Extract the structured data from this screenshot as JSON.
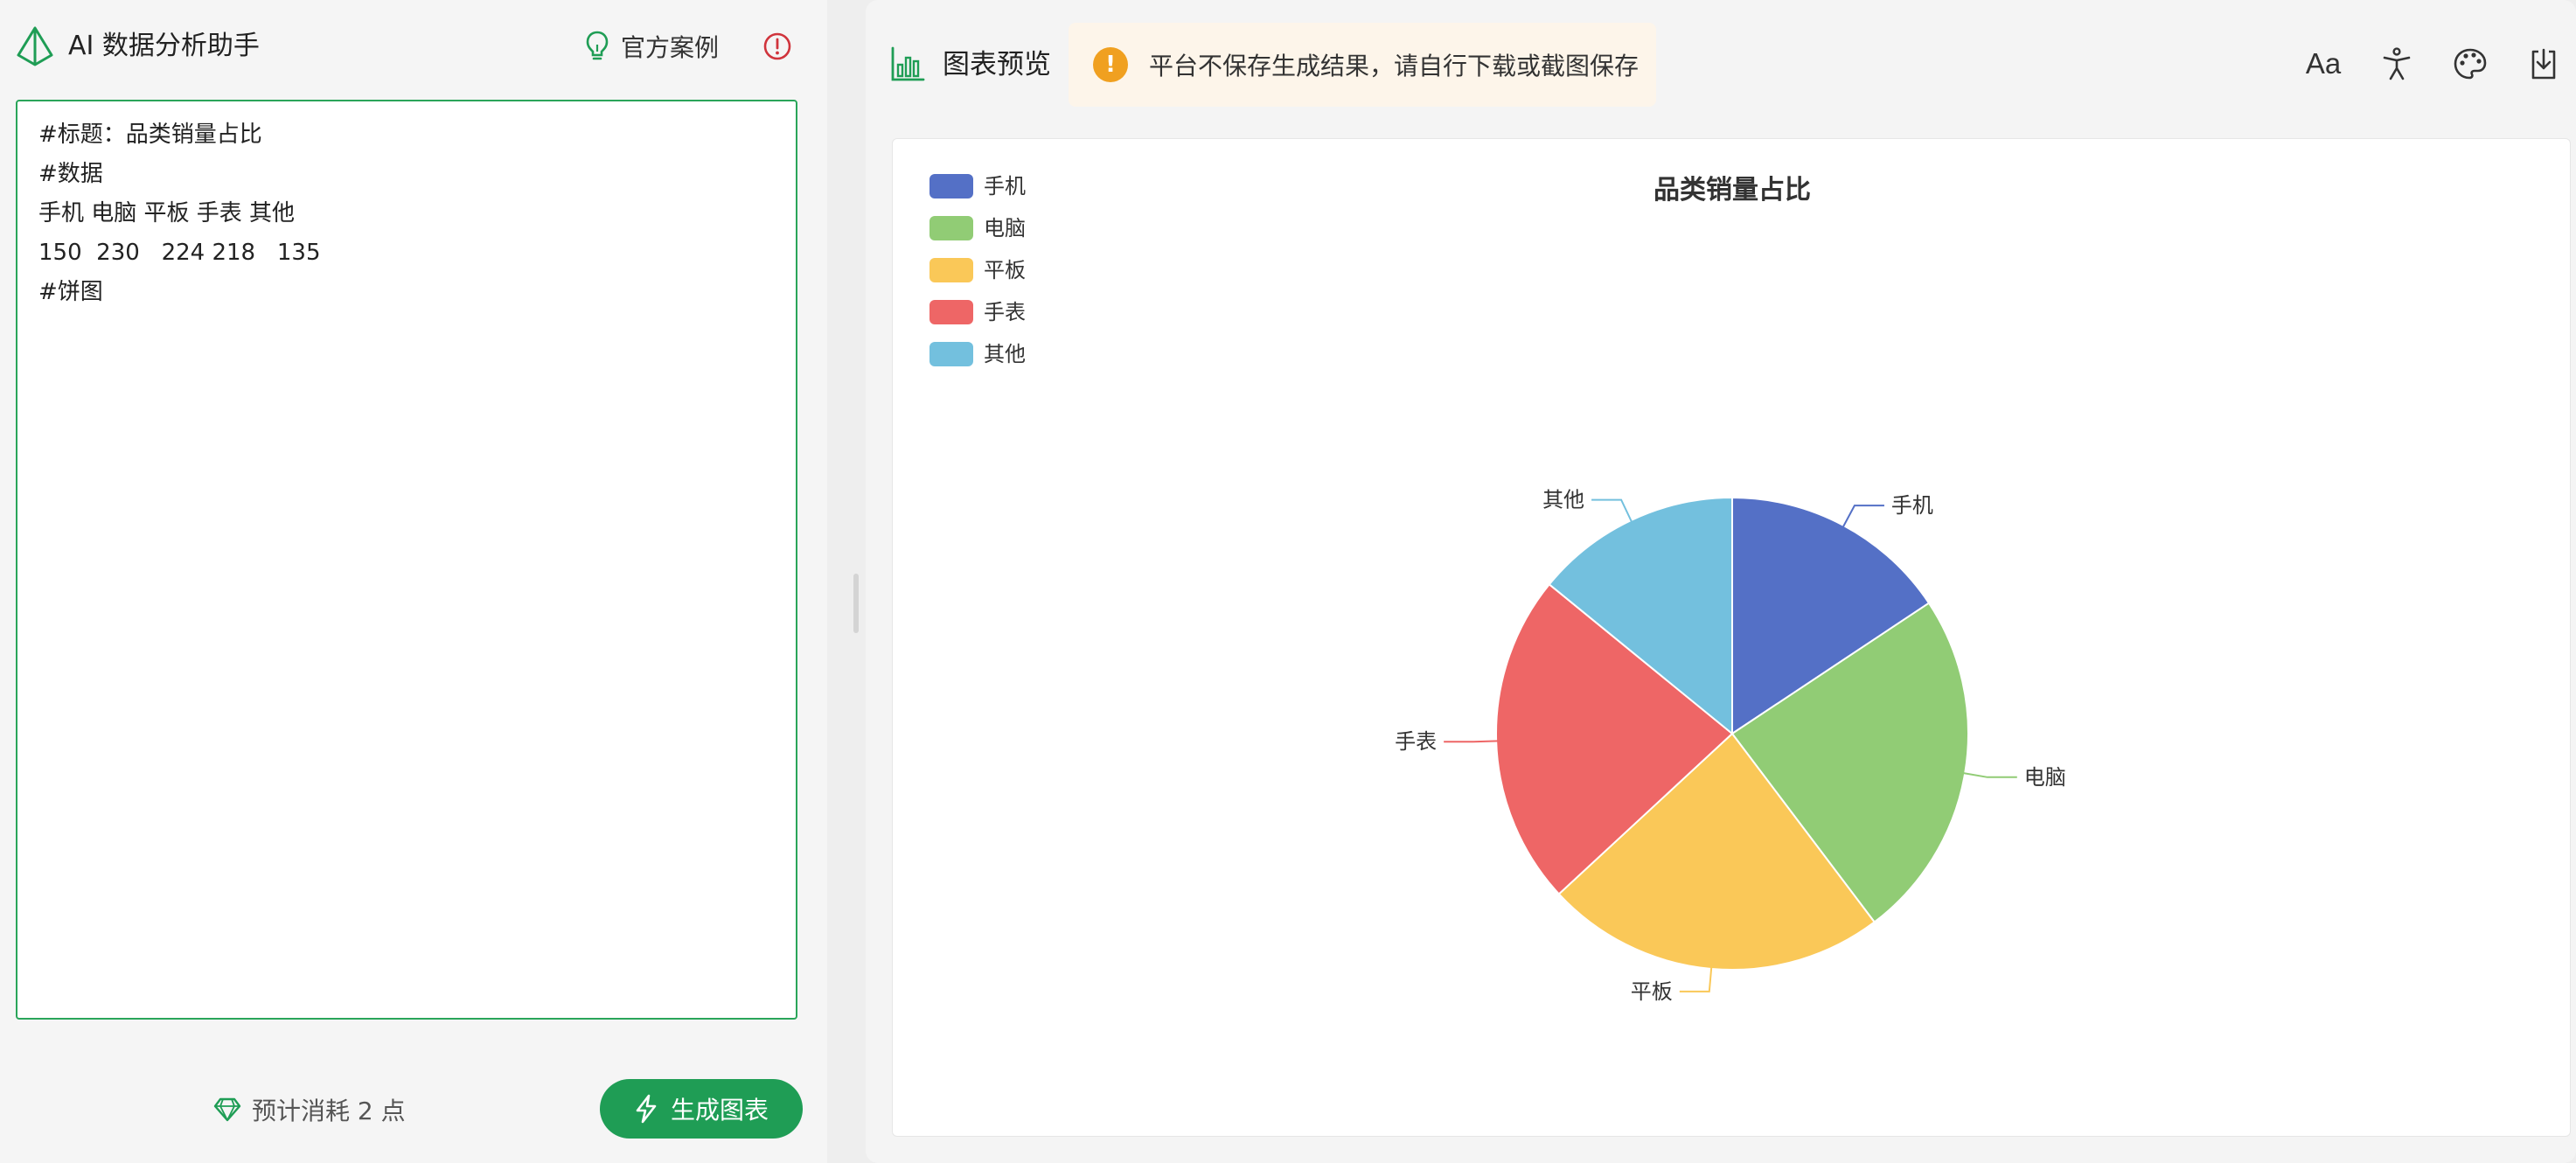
{
  "app": {
    "title": "AI 数据分析助手",
    "examples_label": "官方案例"
  },
  "editor": {
    "lines": [
      "#标题：品类销量占比",
      "#数据",
      "手机 电脑 平板 手表 其他",
      "150  230   224 218   135",
      "#饼图"
    ]
  },
  "footer": {
    "cost_label": "预计消耗 2 点",
    "generate_label": "生成图表"
  },
  "preview": {
    "title": "图表预览",
    "notice": "平台不保存生成结果，请自行下载或截图保存",
    "font_button": "Aa"
  },
  "icons": {
    "logo": "pyramid-logo-icon",
    "examples": "lightbulb-icon",
    "info": "alert-circle-icon",
    "cost": "diamond-icon",
    "generate": "lightning-icon",
    "preview": "bar-chart-icon",
    "notice": "exclamation-icon",
    "accessibility": "accessibility-person-icon",
    "theme": "palette-icon",
    "download": "download-icon"
  },
  "colors": {
    "accent": "#1f9d55",
    "warning": "#f0a020",
    "info_red": "#d0343c"
  },
  "chart_data": {
    "type": "pie",
    "title": "品类销量占比",
    "legend_position": "top-left",
    "categories": [
      "手机",
      "电脑",
      "平板",
      "手表",
      "其他"
    ],
    "values": [
      150,
      230,
      224,
      218,
      135
    ],
    "colors": [
      "#5470c6",
      "#91cc75",
      "#fac858",
      "#ee6666",
      "#73c0de"
    ]
  }
}
